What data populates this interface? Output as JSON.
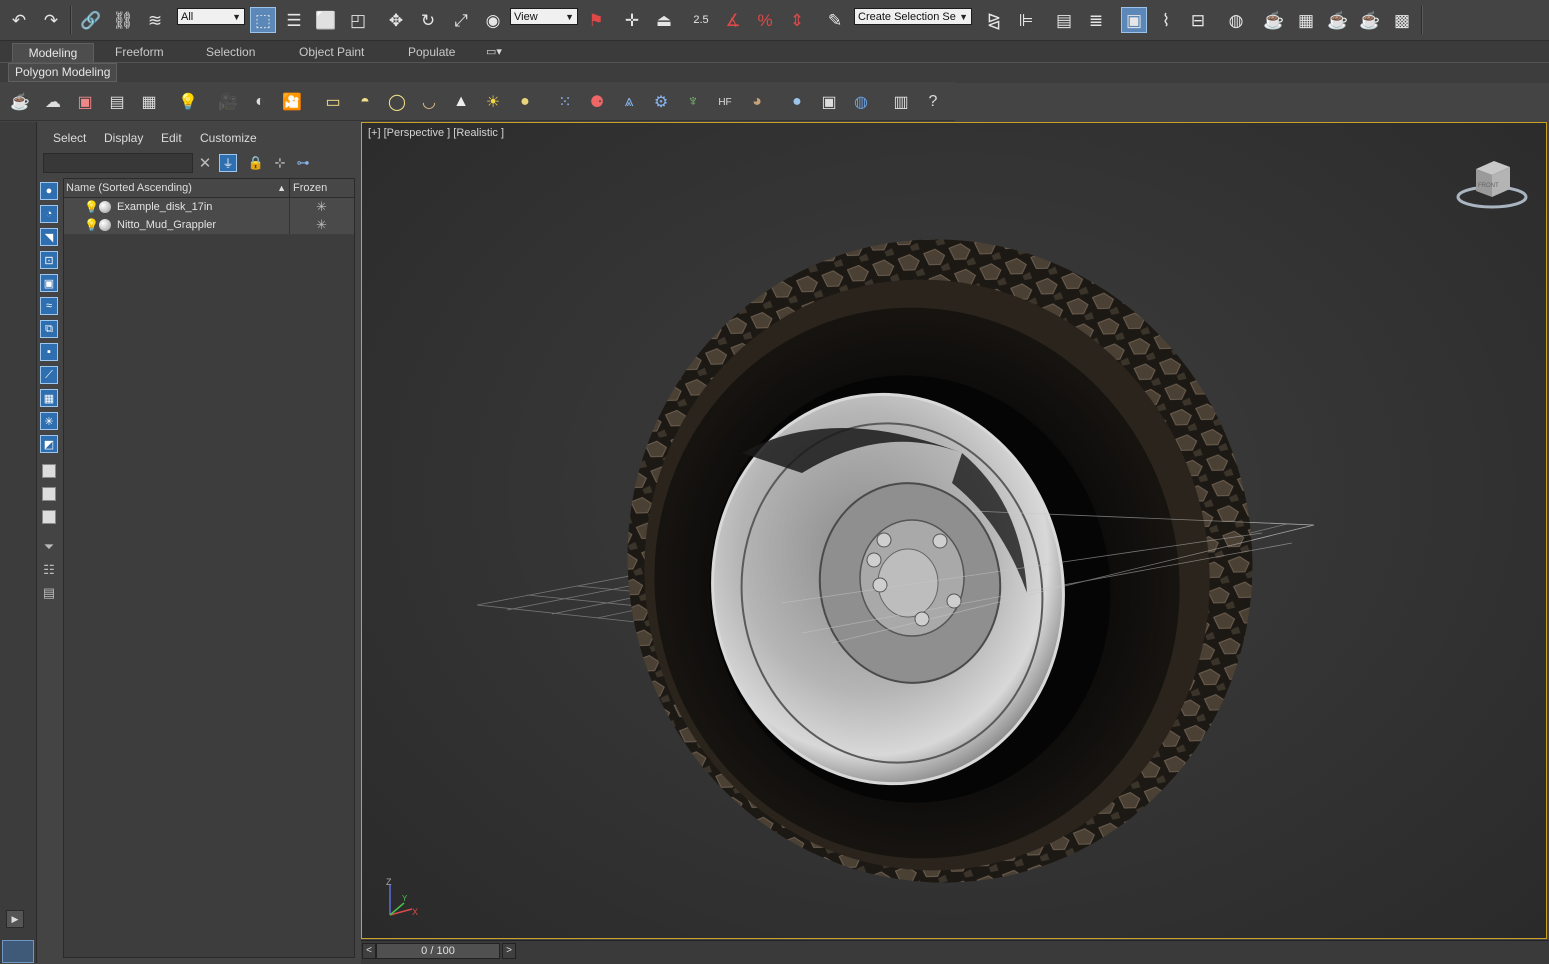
{
  "toolbar": {
    "selection_filter": "All",
    "reference_coord": "View",
    "snap_angle_label": "2.5",
    "named_selection_placeholder": "Create Selection Se"
  },
  "ribbon": {
    "tabs": [
      "Modeling",
      "Freeform",
      "Selection",
      "Object Paint",
      "Populate"
    ],
    "active_tab": "Modeling",
    "panel_label": "Polygon Modeling"
  },
  "scene_explorer": {
    "menu": [
      "Select",
      "Display",
      "Edit",
      "Customize"
    ],
    "columns": {
      "name": "Name (Sorted Ascending)",
      "frozen": "Frozen"
    },
    "sort_indicator": "▲",
    "rows": [
      {
        "name": "Example_disk_17in",
        "frozen": "✳"
      },
      {
        "name": "Nitto_Mud_Grappler",
        "frozen": "✳"
      }
    ]
  },
  "viewport": {
    "label": "[+] [Perspective ] [Realistic ]",
    "view_cube_text": "FRONT",
    "axis": {
      "z": "Z",
      "x": "X",
      "y": "Y"
    },
    "border_color": "#c9a227"
  },
  "timeline": {
    "frame": "0 / 100",
    "prev": "<",
    "next": ">"
  },
  "icons": {
    "undo": "undo-icon",
    "redo": "redo-icon",
    "link": "link-icon",
    "select": "select-object-icon",
    "move": "move-icon",
    "rotate": "rotate-icon",
    "scale": "scale-icon",
    "help": "help-icon"
  },
  "colors": {
    "accent_blue": "#5b88b8",
    "bulb": "#f2d548",
    "viewport_border": "#c9a227"
  }
}
